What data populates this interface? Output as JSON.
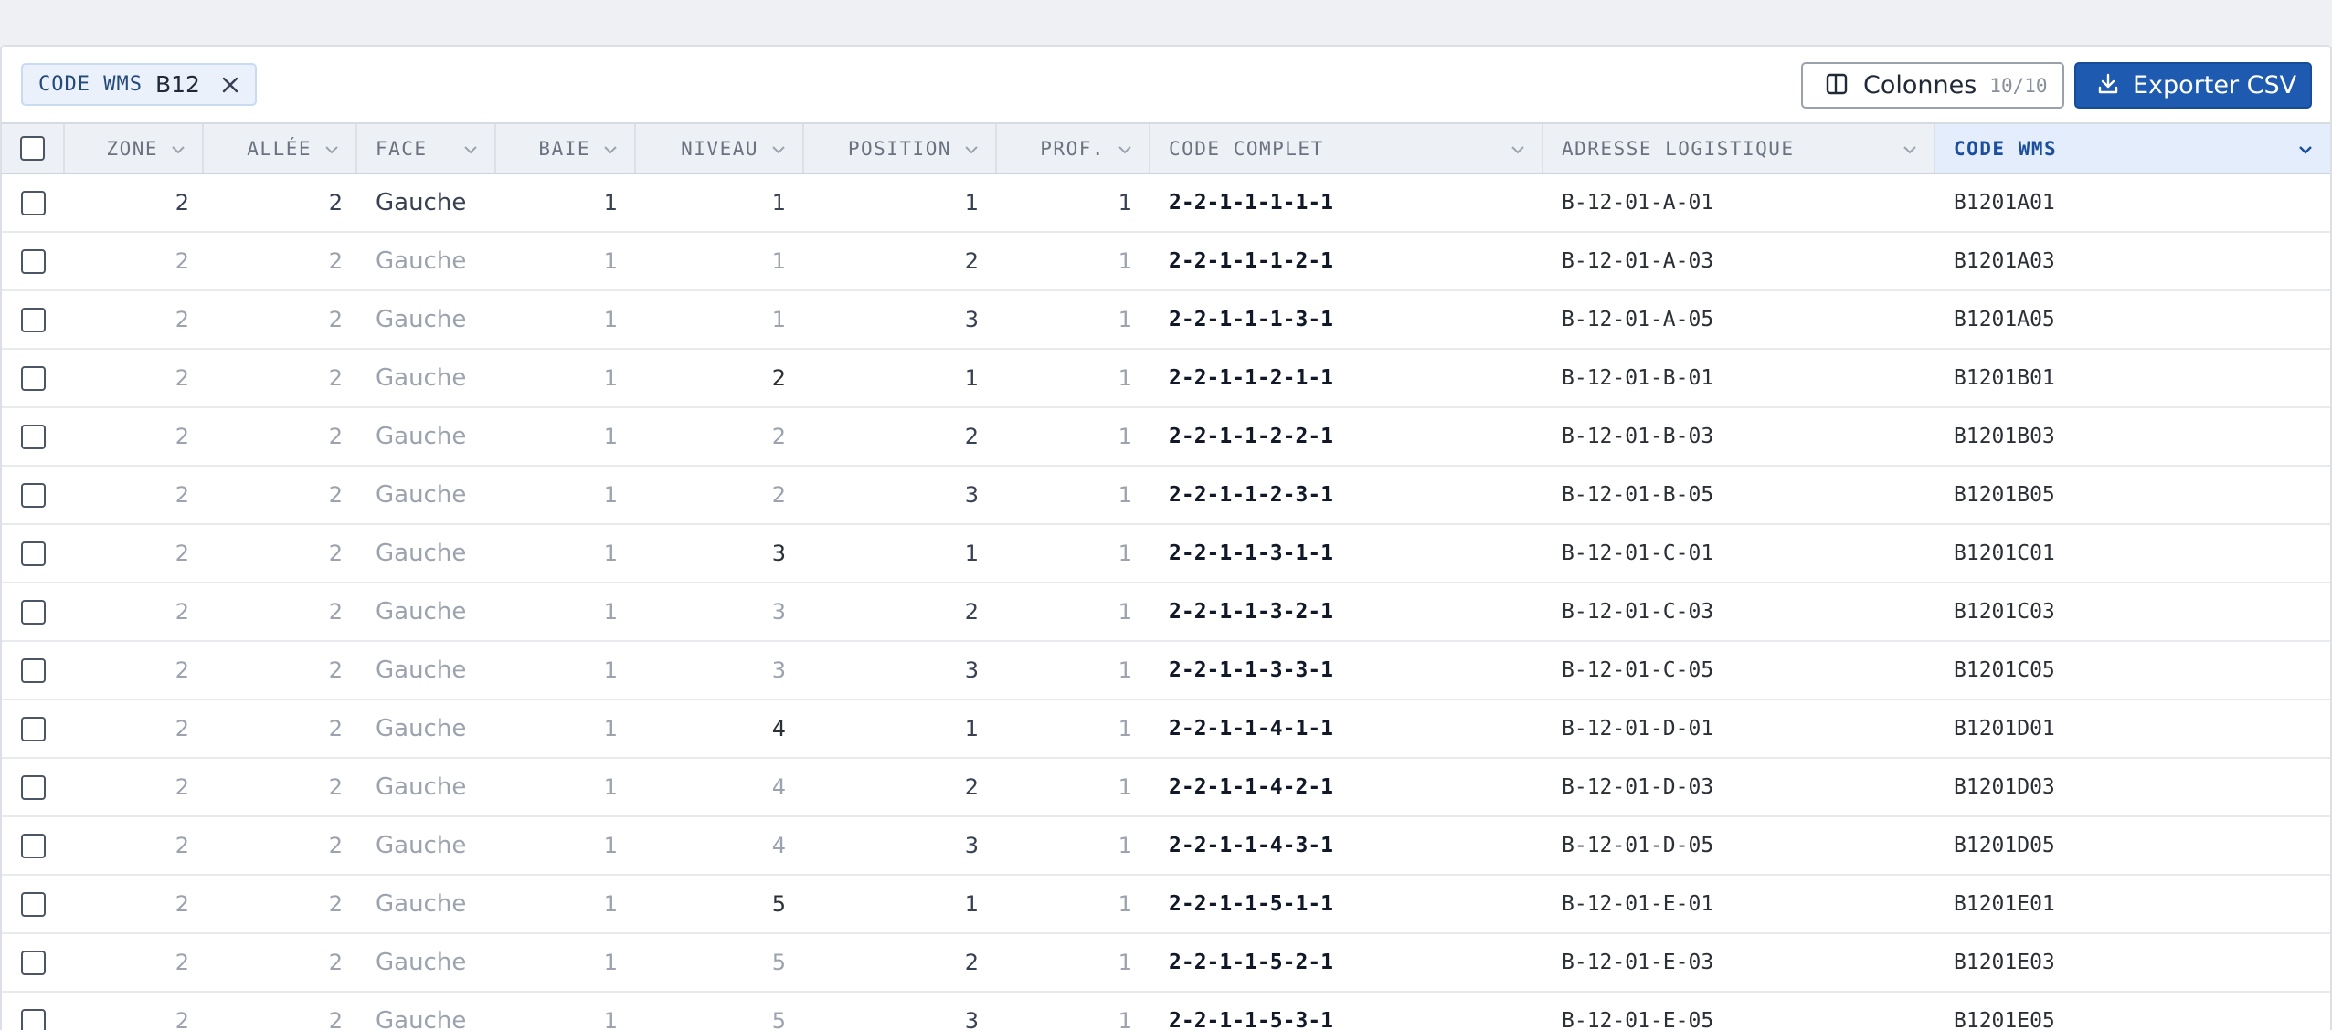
{
  "filter": {
    "key": "CODE WMS",
    "value": "B12"
  },
  "toolbar": {
    "columns_label": "Colonnes",
    "columns_count": "10/10",
    "export_label": "Exporter CSV"
  },
  "columns": [
    {
      "key": "zone",
      "label": "ZONE"
    },
    {
      "key": "allee",
      "label": "ALLÉE"
    },
    {
      "key": "face",
      "label": "FACE"
    },
    {
      "key": "baie",
      "label": "BAIE"
    },
    {
      "key": "niveau",
      "label": "NIVEAU"
    },
    {
      "key": "position",
      "label": "POSITION"
    },
    {
      "key": "prof",
      "label": "PROF."
    },
    {
      "key": "code_complet",
      "label": "CODE COMPLET"
    },
    {
      "key": "adresse",
      "label": "ADRESSE LOGISTIQUE"
    },
    {
      "key": "code_wms",
      "label": "CODE WMS"
    }
  ],
  "rows": [
    {
      "zone": "2",
      "allee": "2",
      "face": "Gauche",
      "baie": "1",
      "niveau": "1",
      "position": "1",
      "prof": "1",
      "code_complet": "2-2-1-1-1-1-1",
      "adresse": "B-12-01-A-01",
      "code_wms": "B1201A01"
    },
    {
      "zone": "2",
      "allee": "2",
      "face": "Gauche",
      "baie": "1",
      "niveau": "1",
      "position": "2",
      "prof": "1",
      "code_complet": "2-2-1-1-1-2-1",
      "adresse": "B-12-01-A-03",
      "code_wms": "B1201A03"
    },
    {
      "zone": "2",
      "allee": "2",
      "face": "Gauche",
      "baie": "1",
      "niveau": "1",
      "position": "3",
      "prof": "1",
      "code_complet": "2-2-1-1-1-3-1",
      "adresse": "B-12-01-A-05",
      "code_wms": "B1201A05"
    },
    {
      "zone": "2",
      "allee": "2",
      "face": "Gauche",
      "baie": "1",
      "niveau": "2",
      "position": "1",
      "prof": "1",
      "code_complet": "2-2-1-1-2-1-1",
      "adresse": "B-12-01-B-01",
      "code_wms": "B1201B01"
    },
    {
      "zone": "2",
      "allee": "2",
      "face": "Gauche",
      "baie": "1",
      "niveau": "2",
      "position": "2",
      "prof": "1",
      "code_complet": "2-2-1-1-2-2-1",
      "adresse": "B-12-01-B-03",
      "code_wms": "B1201B03"
    },
    {
      "zone": "2",
      "allee": "2",
      "face": "Gauche",
      "baie": "1",
      "niveau": "2",
      "position": "3",
      "prof": "1",
      "code_complet": "2-2-1-1-2-3-1",
      "adresse": "B-12-01-B-05",
      "code_wms": "B1201B05"
    },
    {
      "zone": "2",
      "allee": "2",
      "face": "Gauche",
      "baie": "1",
      "niveau": "3",
      "position": "1",
      "prof": "1",
      "code_complet": "2-2-1-1-3-1-1",
      "adresse": "B-12-01-C-01",
      "code_wms": "B1201C01"
    },
    {
      "zone": "2",
      "allee": "2",
      "face": "Gauche",
      "baie": "1",
      "niveau": "3",
      "position": "2",
      "prof": "1",
      "code_complet": "2-2-1-1-3-2-1",
      "adresse": "B-12-01-C-03",
      "code_wms": "B1201C03"
    },
    {
      "zone": "2",
      "allee": "2",
      "face": "Gauche",
      "baie": "1",
      "niveau": "3",
      "position": "3",
      "prof": "1",
      "code_complet": "2-2-1-1-3-3-1",
      "adresse": "B-12-01-C-05",
      "code_wms": "B1201C05"
    },
    {
      "zone": "2",
      "allee": "2",
      "face": "Gauche",
      "baie": "1",
      "niveau": "4",
      "position": "1",
      "prof": "1",
      "code_complet": "2-2-1-1-4-1-1",
      "adresse": "B-12-01-D-01",
      "code_wms": "B1201D01"
    },
    {
      "zone": "2",
      "allee": "2",
      "face": "Gauche",
      "baie": "1",
      "niveau": "4",
      "position": "2",
      "prof": "1",
      "code_complet": "2-2-1-1-4-2-1",
      "adresse": "B-12-01-D-03",
      "code_wms": "B1201D03"
    },
    {
      "zone": "2",
      "allee": "2",
      "face": "Gauche",
      "baie": "1",
      "niveau": "4",
      "position": "3",
      "prof": "1",
      "code_complet": "2-2-1-1-4-3-1",
      "adresse": "B-12-01-D-05",
      "code_wms": "B1201D05"
    },
    {
      "zone": "2",
      "allee": "2",
      "face": "Gauche",
      "baie": "1",
      "niveau": "5",
      "position": "1",
      "prof": "1",
      "code_complet": "2-2-1-1-5-1-1",
      "adresse": "B-12-01-E-01",
      "code_wms": "B1201E01"
    },
    {
      "zone": "2",
      "allee": "2",
      "face": "Gauche",
      "baie": "1",
      "niveau": "5",
      "position": "2",
      "prof": "1",
      "code_complet": "2-2-1-1-5-2-1",
      "adresse": "B-12-01-E-03",
      "code_wms": "B1201E03"
    },
    {
      "zone": "2",
      "allee": "2",
      "face": "Gauche",
      "baie": "1",
      "niveau": "5",
      "position": "3",
      "prof": "1",
      "code_complet": "2-2-1-1-5-3-1",
      "adresse": "B-12-01-E-05",
      "code_wms": "B1201E05"
    }
  ],
  "colors": {
    "accent": "#1d5ab0",
    "active_header_bg": "#e3edfb",
    "muted_text": "#9ca3af"
  }
}
